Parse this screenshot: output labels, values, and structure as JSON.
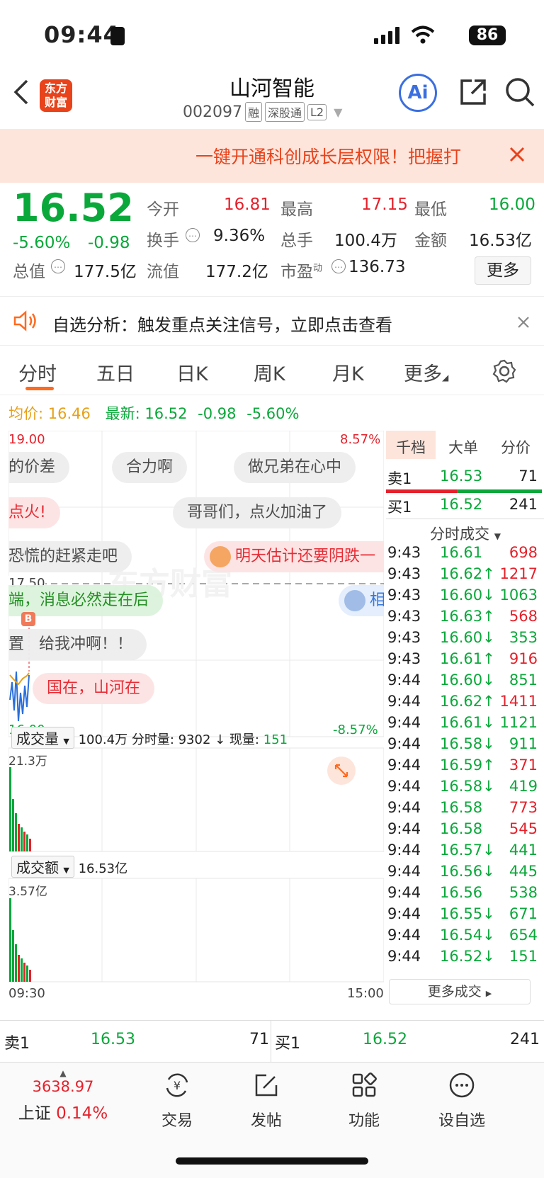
{
  "status": {
    "time": "09:44",
    "battery": "86"
  },
  "header": {
    "logo_text": "东方财富",
    "title": "山河智能",
    "code": "002097",
    "tags": [
      "融",
      "深股通",
      "L2"
    ],
    "ai_label": "Ai"
  },
  "banner": {
    "text": "一键开通科创成长层权限！把握打"
  },
  "quote": {
    "price": "16.52",
    "change_pct": "-5.60%",
    "change": "-0.98",
    "open_label": "今开",
    "open": "16.81",
    "high_label": "最高",
    "high": "17.15",
    "low_label": "最低",
    "low": "16.00",
    "turnover_label": "换手",
    "turnover": "9.36%",
    "volume_label": "总手",
    "volume": "100.4万",
    "amount_label": "金额",
    "amount": "16.53亿",
    "mktcap_label": "总值",
    "mktcap": "177.5亿",
    "float_label": "流值",
    "float": "177.2亿",
    "pe_label": "市盈",
    "pe_sup": "动",
    "pe": "136.73",
    "more_label": "更多"
  },
  "notice": {
    "text": "自选分析：触发重点关注信号，立即点击查看"
  },
  "tabs": [
    "分时",
    "五日",
    "日K",
    "周K",
    "月K",
    "更多"
  ],
  "active_tab": "分时",
  "infoline": {
    "avg_label": "均价:",
    "avg": "16.46",
    "latest_label": "最新:",
    "latest": "16.52",
    "change": "-0.98",
    "change_pct": "-5.60%"
  },
  "chart": {
    "price_top": "19.00",
    "pct_top": "8.57%",
    "price_bottom": "16.00",
    "pct_bottom": "-8.57%",
    "ref_line": "17.50",
    "watermark": "东方财富",
    "vol_label": "成交量",
    "vol_summary": "100.4万 分时量: 9302 ↓ 现量: ",
    "vol_now": "151",
    "vol_max": "21.3万",
    "amt_label": "成交额",
    "amt_summary": "16.53亿",
    "amt_max": "3.57亿",
    "time_start": "09:30",
    "time_end": "15:00",
    "marker": "B",
    "comments": [
      "的价差",
      "合力啊",
      "做兄弟在心中",
      "点火!",
      "哥哥们，点火加油了",
      "恐慌的赶紧走吧",
      "明天估计还要阴跌一",
      "端，消息必然走在后",
      "相",
      "置",
      "给我冲啊！！",
      "国在，山河在"
    ]
  },
  "right_panel": {
    "tabs": [
      "千档",
      "大单",
      "分价"
    ],
    "sell1_label": "卖1",
    "sell1_price": "16.53",
    "sell1_vol": "71",
    "buy1_label": "买1",
    "buy1_price": "16.52",
    "buy1_vol": "241",
    "ticks_title": "分时成交",
    "ticks": [
      {
        "t": "9:43",
        "p": "16.61",
        "d": "",
        "v": "698",
        "c": "red"
      },
      {
        "t": "9:43",
        "p": "16.62↑",
        "d": "",
        "v": "1217",
        "c": "red"
      },
      {
        "t": "9:43",
        "p": "16.60↓",
        "d": "",
        "v": "1063",
        "c": "green"
      },
      {
        "t": "9:43",
        "p": "16.63↑",
        "d": "",
        "v": "568",
        "c": "red"
      },
      {
        "t": "9:43",
        "p": "16.60↓",
        "d": "",
        "v": "353",
        "c": "green"
      },
      {
        "t": "9:43",
        "p": "16.61↑",
        "d": "",
        "v": "916",
        "c": "red"
      },
      {
        "t": "9:44",
        "p": "16.60↓",
        "d": "",
        "v": "851",
        "c": "green"
      },
      {
        "t": "9:44",
        "p": "16.62↑",
        "d": "",
        "v": "1411",
        "c": "red"
      },
      {
        "t": "9:44",
        "p": "16.61↓",
        "d": "",
        "v": "1121",
        "c": "green"
      },
      {
        "t": "9:44",
        "p": "16.58↓",
        "d": "",
        "v": "911",
        "c": "green"
      },
      {
        "t": "9:44",
        "p": "16.59↑",
        "d": "",
        "v": "371",
        "c": "red"
      },
      {
        "t": "9:44",
        "p": "16.58↓",
        "d": "",
        "v": "419",
        "c": "green"
      },
      {
        "t": "9:44",
        "p": "16.58",
        "d": "",
        "v": "773",
        "c": "red"
      },
      {
        "t": "9:44",
        "p": "16.58",
        "d": "",
        "v": "545",
        "c": "red"
      },
      {
        "t": "9:44",
        "p": "16.57↓",
        "d": "",
        "v": "441",
        "c": "green"
      },
      {
        "t": "9:44",
        "p": "16.56↓",
        "d": "",
        "v": "445",
        "c": "green"
      },
      {
        "t": "9:44",
        "p": "16.56",
        "d": "",
        "v": "538",
        "c": "green"
      },
      {
        "t": "9:44",
        "p": "16.55↓",
        "d": "",
        "v": "671",
        "c": "green"
      },
      {
        "t": "9:44",
        "p": "16.54↓",
        "d": "",
        "v": "654",
        "c": "green"
      },
      {
        "t": "9:44",
        "p": "16.52↓",
        "d": "",
        "v": "151",
        "c": "green"
      }
    ],
    "more_ticks": "更多成交"
  },
  "bidask": {
    "sell_label": "卖1",
    "sell_price": "16.53",
    "sell_vol": "71",
    "buy_label": "买1",
    "buy_price": "16.52",
    "buy_vol": "241"
  },
  "bottomnav": {
    "index_value": "3638.97",
    "index_name": "上证",
    "index_pct": "0.14%",
    "items": [
      "交易",
      "发帖",
      "功能",
      "设自选"
    ]
  }
}
